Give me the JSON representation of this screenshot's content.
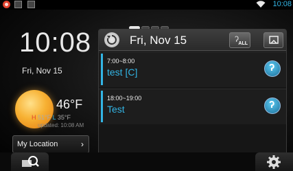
{
  "status_bar": {
    "time": "10:08",
    "icons": [
      "notification-icon",
      "list-icon",
      "download-icon",
      "wifi-icon"
    ]
  },
  "left": {
    "clock": "10:08",
    "date": "Fri, Nov 15",
    "weather": {
      "icon": "sunny-icon",
      "temp": "46°F",
      "high_label": "H",
      "high": "51°F",
      "low_label": "L",
      "low": "35°F",
      "updated": "updated: 10:08 AM"
    },
    "location_button": "My Location",
    "location_chevron": "›"
  },
  "pager": {
    "pages": 4,
    "active": 0
  },
  "calendar": {
    "date": "Fri, Nov 15",
    "all_button": "ALL",
    "events": [
      {
        "time": "7:00~8:00",
        "title": "test [C]"
      },
      {
        "time": "18:00~19:00",
        "title": "Test"
      }
    ]
  },
  "colors": {
    "accent": "#33b5e5",
    "high": "#e0412d"
  }
}
